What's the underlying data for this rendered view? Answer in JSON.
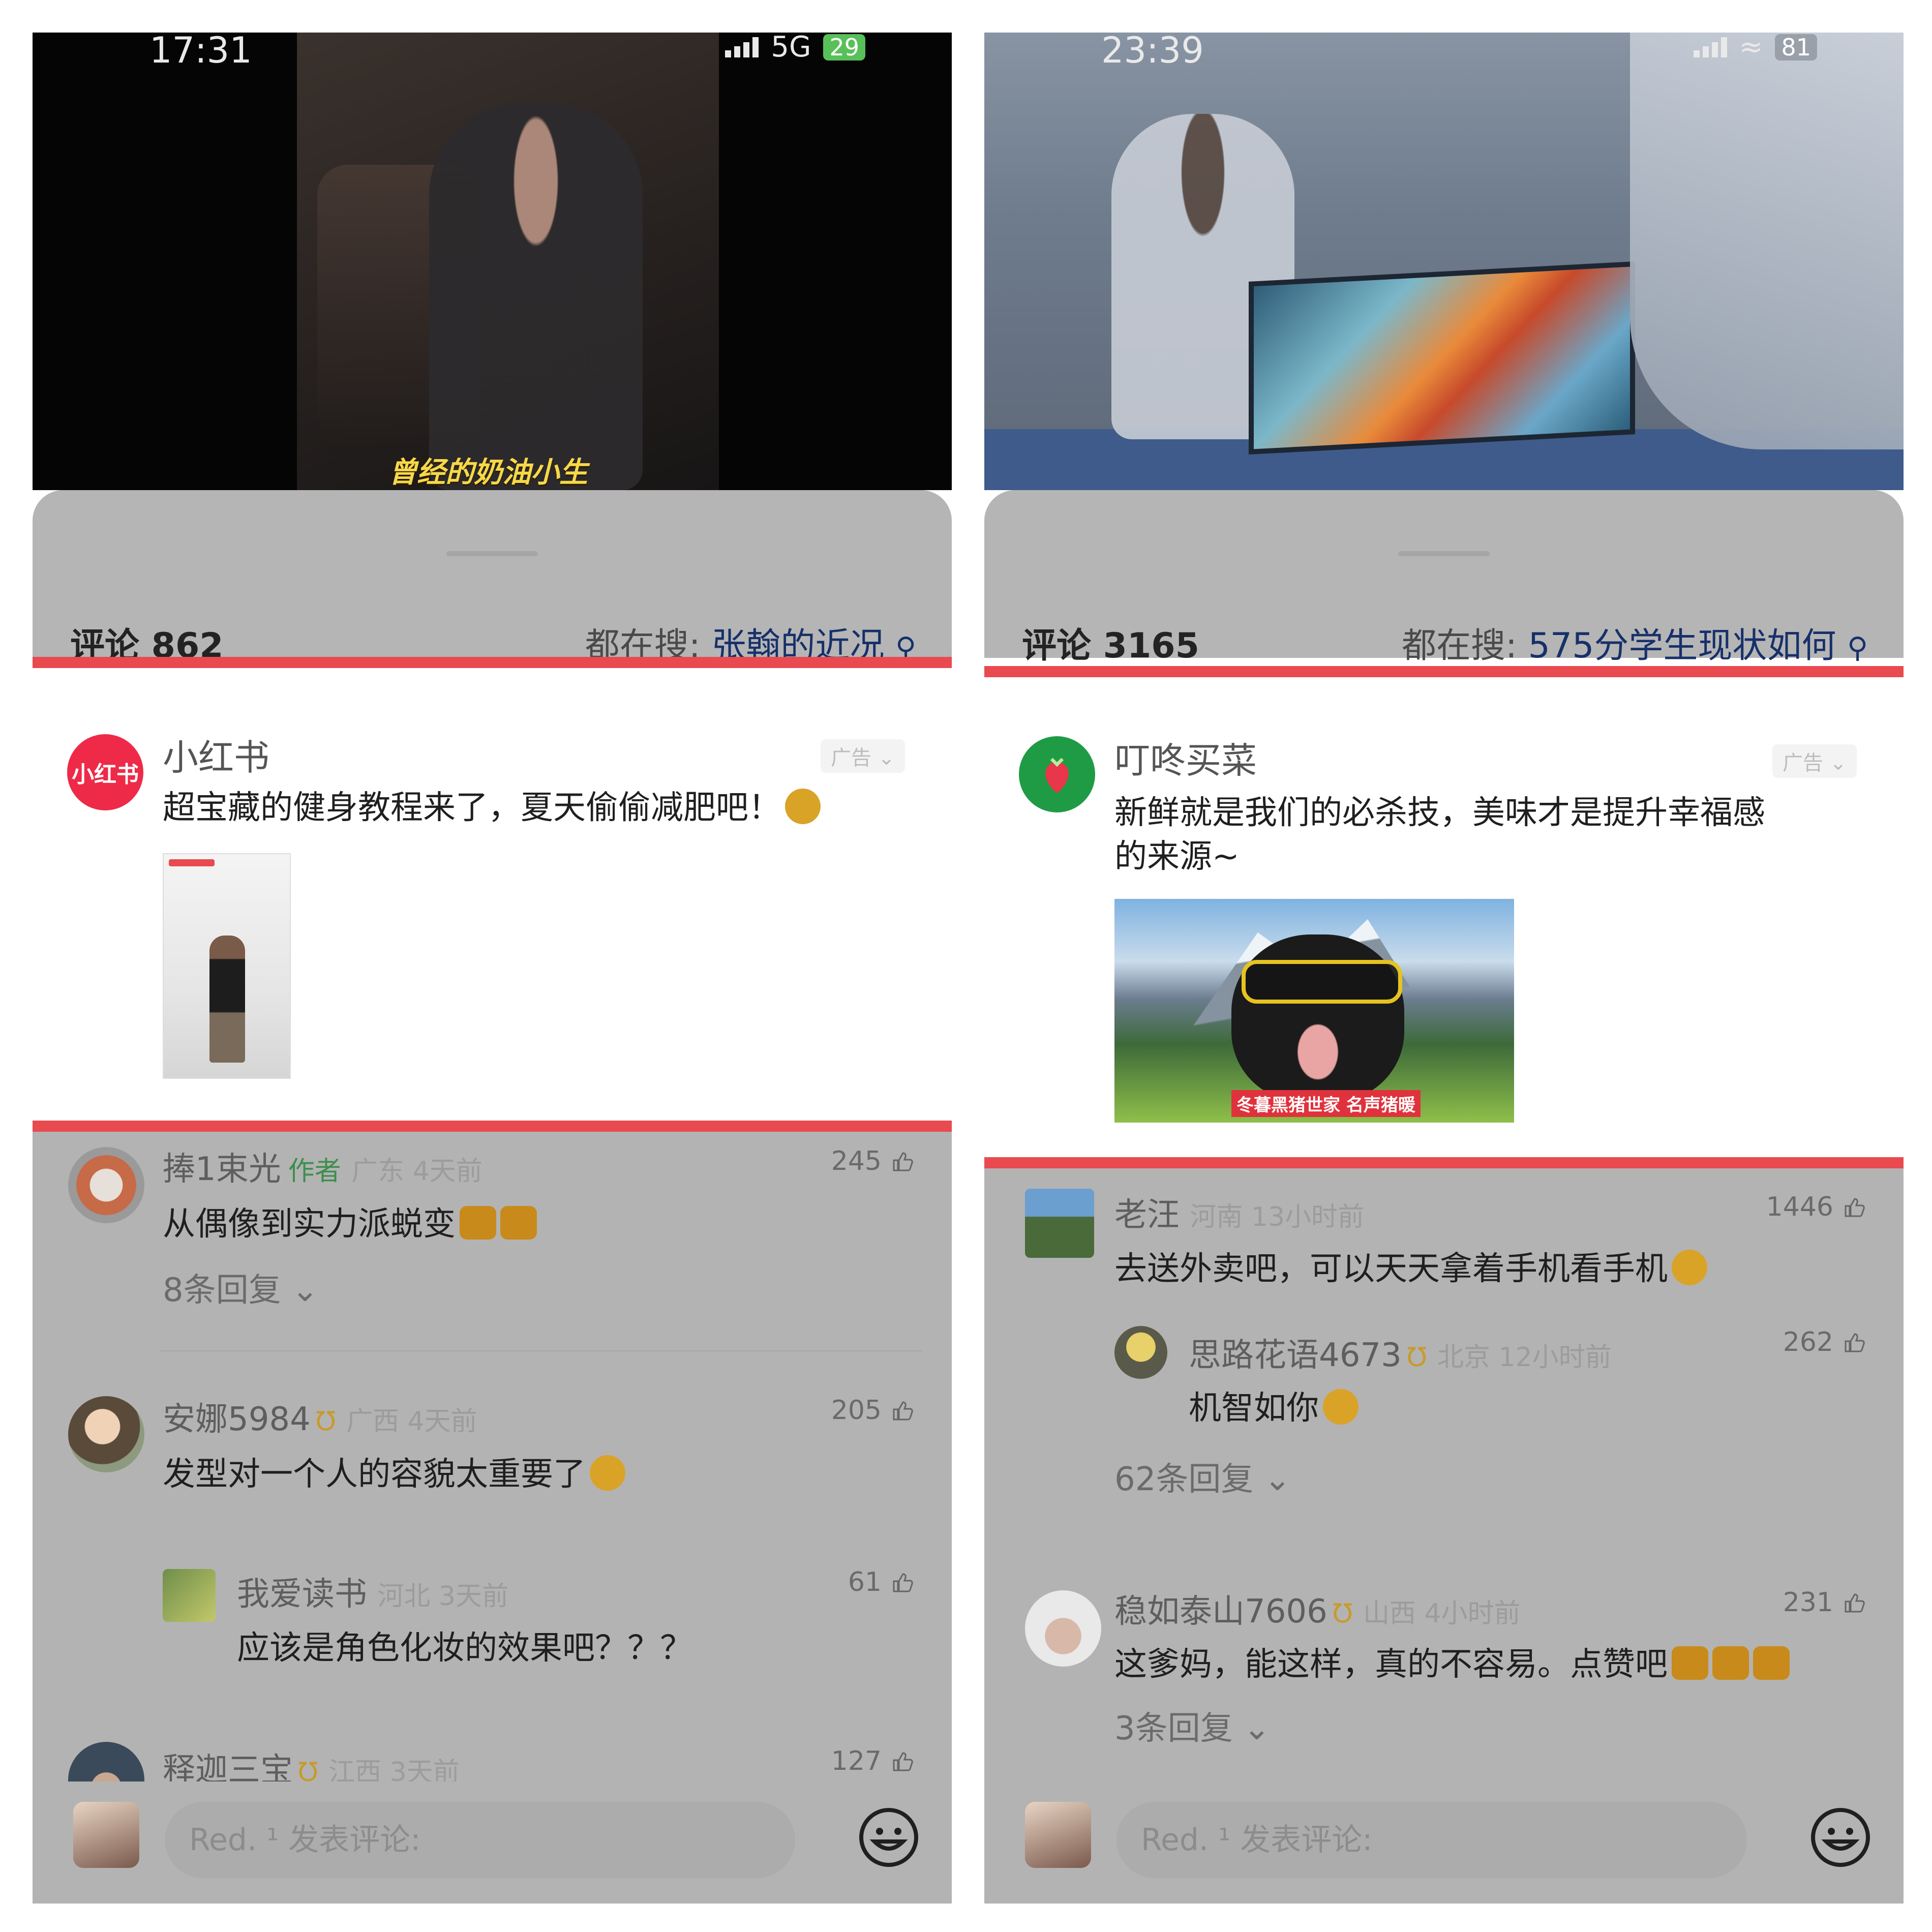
{
  "left": {
    "status": {
      "time": "17:31",
      "network": "5G",
      "battery": "29"
    },
    "video_caption": "曾经的奶油小生",
    "comment_header": {
      "count_label": "评论 862",
      "search_prefix": "都在搜:",
      "search_keyword": "张翰的近况"
    },
    "ad": {
      "avatar_text": "小红书",
      "brand": "小红书",
      "tag": "广告",
      "text": "超宝藏的健身教程来了，夏天偷偷减肥吧！"
    },
    "comments": [
      {
        "name": "捧1束光",
        "author": "作者",
        "meta": "广东 4天前",
        "likes": "245",
        "text": "从偶像到实力派蜕变",
        "reply_toggle": "8条回复"
      },
      {
        "name": "安娜5984",
        "meta": "广西 4天前",
        "likes": "205",
        "text": "发型对一个人的容貌太重要了"
      },
      {
        "name": "我爱读书",
        "meta": "河北 3天前",
        "likes": "61",
        "text": "应该是角色化妆的效果吧？？？",
        "is_reply": true
      },
      {
        "name": "释迦三宝",
        "meta": "江西 3天前",
        "likes": "127"
      }
    ],
    "input_placeholder": "Red. ¹ 发表评论:"
  },
  "right": {
    "status": {
      "time": "23:39",
      "battery": "81"
    },
    "comment_header": {
      "count_label": "评论 3165",
      "search_prefix": "都在搜:",
      "search_keyword": "575分学生现状如何"
    },
    "ad": {
      "brand": "叮咚买菜",
      "tag": "广告",
      "text_line1": "新鲜就是我们的必杀技，美味才是提升幸福感",
      "text_line2": "的来源~",
      "image_caption": "冬暮黑猪世家 名声猪暖"
    },
    "comments": [
      {
        "name": "老汪",
        "meta": "河南 13小时前",
        "likes": "1446",
        "text": "去送外卖吧，可以天天拿着手机看手机"
      },
      {
        "name": "思路花语4673",
        "meta": "北京 12小时前",
        "likes": "262",
        "text": "机智如你",
        "is_reply": true
      },
      {
        "reply_toggle": "62条回复"
      },
      {
        "name": "稳如泰山7606",
        "meta": "山西 4小时前",
        "likes": "231",
        "text": "这爹妈，能这样，真的不容易。点赞吧",
        "reply_toggle": "3条回复"
      }
    ],
    "input_placeholder": "Red. ¹ 发表评论:"
  },
  "colors": {
    "accent_red": "#e84a50",
    "link_blue": "#16306a",
    "dim_gray": "#b4b4b4"
  }
}
